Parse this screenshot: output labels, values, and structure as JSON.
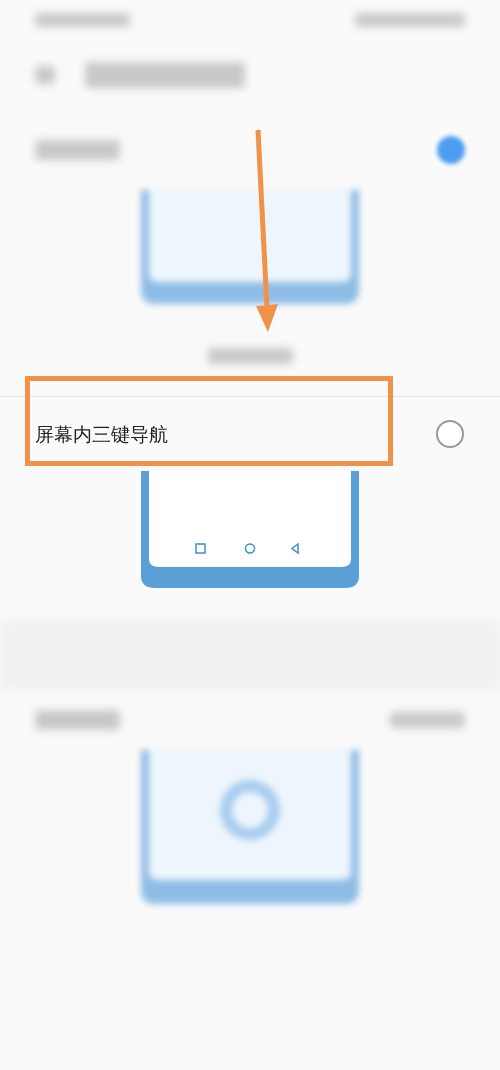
{
  "options": [
    {
      "selected": true
    },
    {
      "label": "屏幕内三键导航",
      "selected": false
    }
  ]
}
